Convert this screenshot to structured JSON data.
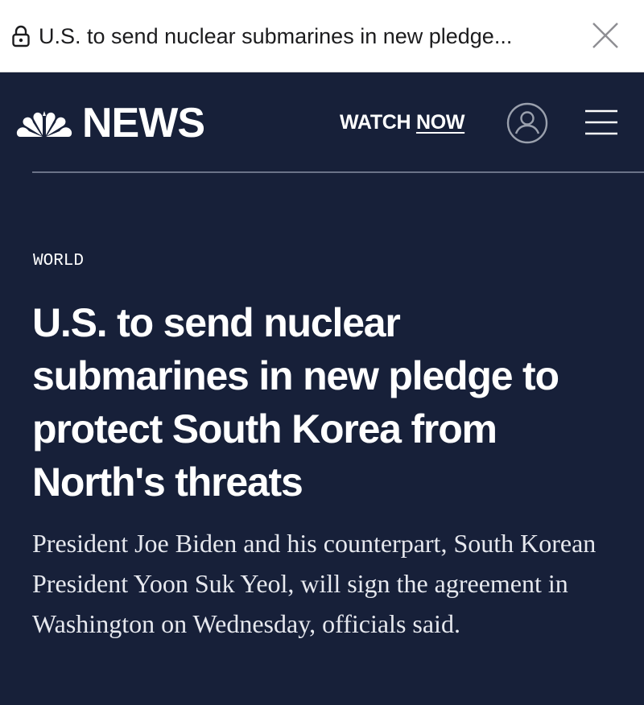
{
  "browser": {
    "page_title": "U.S. to send nuclear submarines in new pledge...",
    "lock_icon": "lock-icon",
    "close_icon": "close-icon"
  },
  "header": {
    "brand": "NEWS",
    "logo_icon": "nbc-peacock-icon",
    "watch_label": "WATCH",
    "watch_now_label": "NOW",
    "account_icon": "user-icon",
    "menu_icon": "hamburger-menu-icon"
  },
  "article": {
    "section": "WORLD",
    "headline": "U.S. to send nuclear submarines in new pledge to protect South Korea from North's threats",
    "dek": "President Joe Biden and his counterpart, South Korean President Yoon Suk Yeol, will sign the agreement in Washington on Wednesday, officials said."
  },
  "colors": {
    "background": "#172039",
    "text": "#ffffff",
    "topbar": "#ffffff"
  }
}
